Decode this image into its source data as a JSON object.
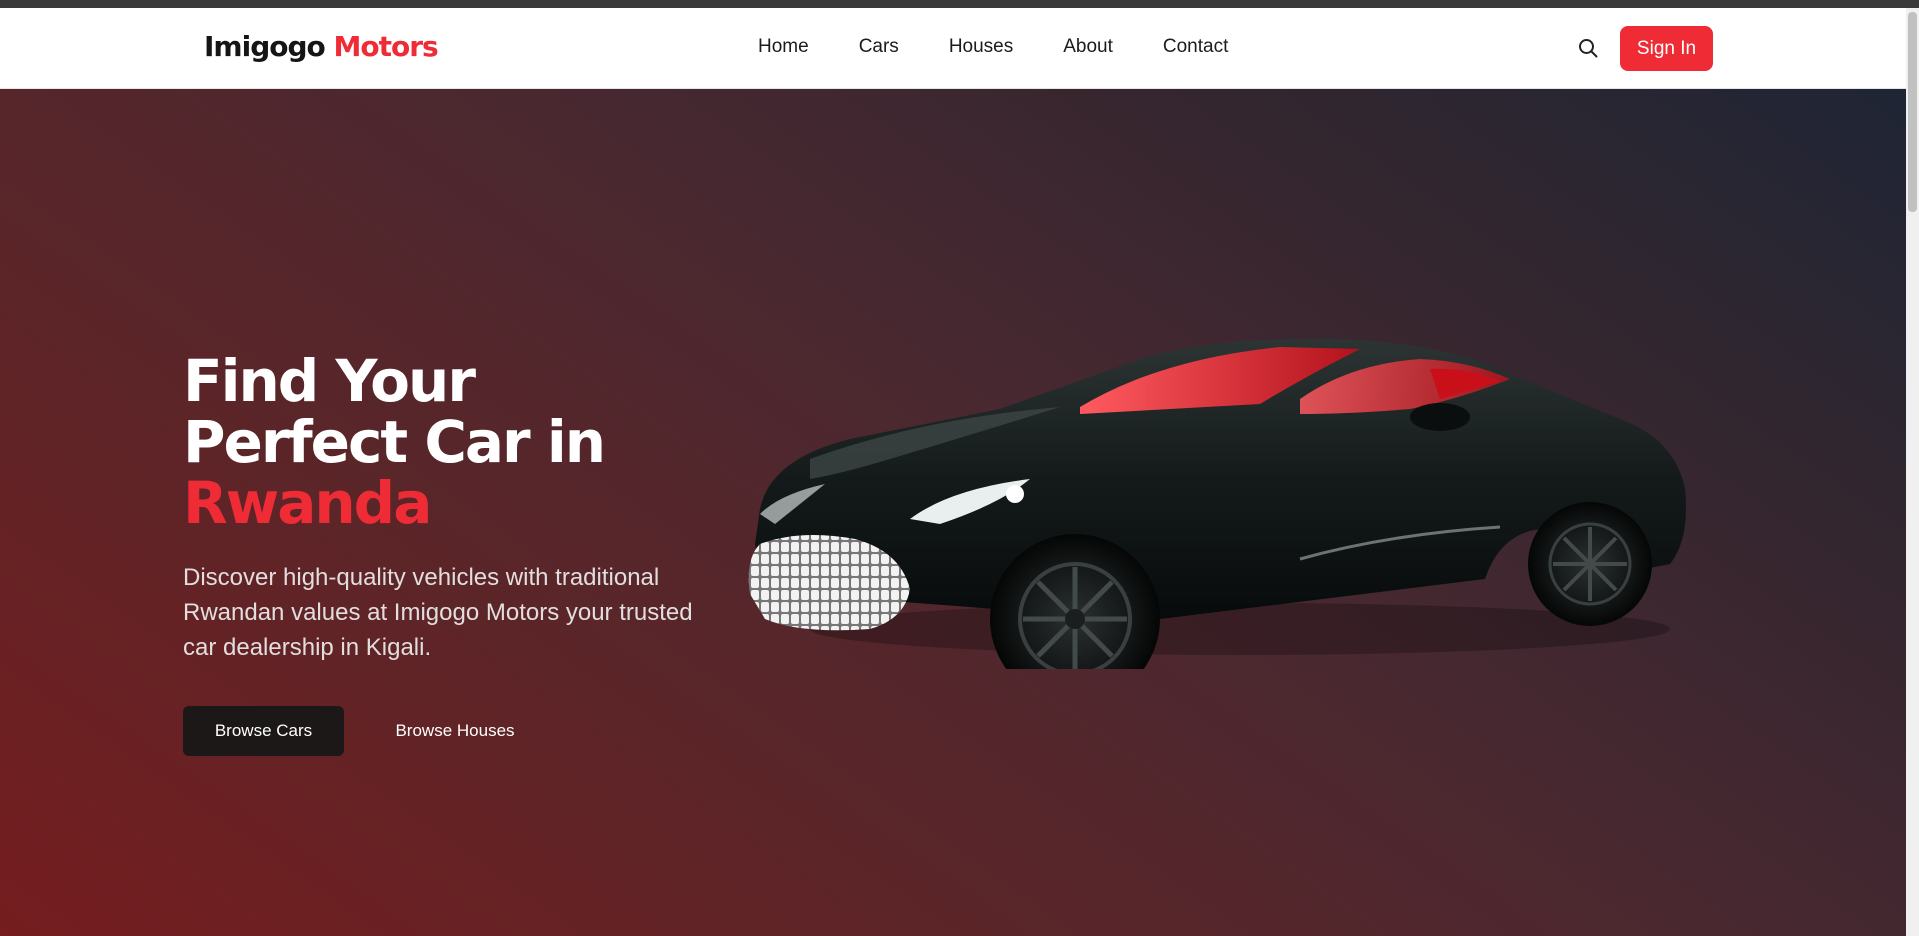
{
  "brand": {
    "name_part1": "Imigogo",
    "name_part2": "Motors",
    "accent_color": "#ef2b36"
  },
  "nav": {
    "links": [
      "Home",
      "Cars",
      "Houses",
      "About",
      "Contact"
    ],
    "search_icon": "search-icon",
    "signin_label": "Sign In"
  },
  "hero": {
    "title_line1": "Find Your",
    "title_line2": "Perfect Car in",
    "title_highlight": "Rwanda",
    "description": "Discover high-quality vehicles with traditional Rwandan values at Imigogo Motors your trusted car dealership in Kigali.",
    "primary_button": "Browse Cars",
    "secondary_button": "Browse Houses",
    "image": "black sports car"
  }
}
